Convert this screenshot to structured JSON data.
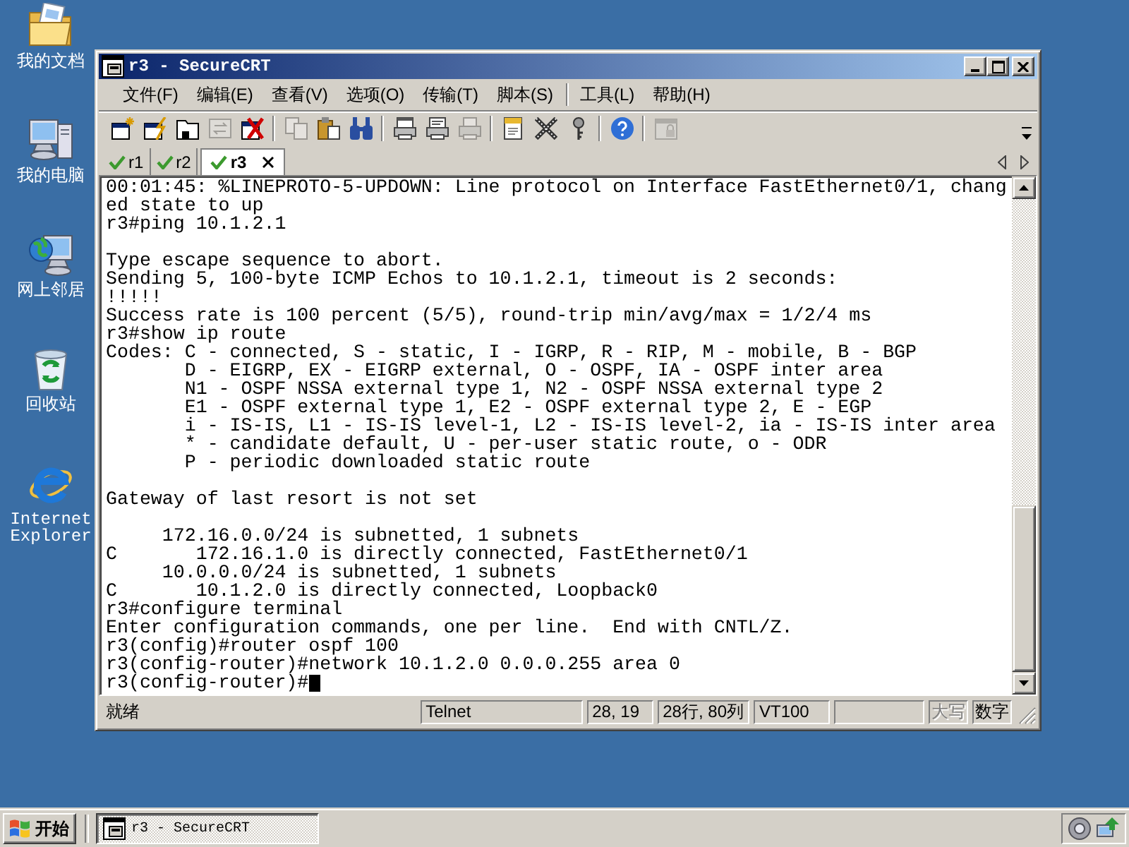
{
  "desktop_icons": [
    {
      "label": "我的文档",
      "kind": "documents"
    },
    {
      "label": "我的电脑",
      "kind": "computer"
    },
    {
      "label": "网上邻居",
      "kind": "network"
    },
    {
      "label": "回收站",
      "kind": "recycle-bin"
    },
    {
      "label": "Internet Explorer",
      "kind": "browser"
    }
  ],
  "window": {
    "title": "r3 - SecureCRT"
  },
  "menu": {
    "groups": [
      [
        "文件(F)",
        "编辑(E)",
        "查看(V)",
        "选项(O)",
        "传输(T)",
        "脚本(S)"
      ],
      [
        "工具(L)",
        "帮助(H)"
      ]
    ]
  },
  "toolbar": {
    "groups": [
      [
        {
          "kind": "new-session",
          "disabled": false
        },
        {
          "kind": "quick-connect",
          "disabled": false
        },
        {
          "kind": "connect-tab",
          "disabled": false
        },
        {
          "kind": "reconnect",
          "disabled": true
        },
        {
          "kind": "disconnect",
          "disabled": false
        }
      ],
      [
        {
          "kind": "copy",
          "disabled": true
        },
        {
          "kind": "paste",
          "disabled": false
        },
        {
          "kind": "find",
          "disabled": false
        }
      ],
      [
        {
          "kind": "print-screen",
          "disabled": false
        },
        {
          "kind": "print-selection",
          "disabled": false
        },
        {
          "kind": "print",
          "disabled": true
        }
      ],
      [
        {
          "kind": "properties",
          "disabled": false
        },
        {
          "kind": "keymap",
          "disabled": false
        },
        {
          "kind": "key",
          "disabled": false
        }
      ],
      [
        {
          "kind": "help",
          "disabled": false
        }
      ],
      [
        {
          "kind": "lock",
          "disabled": true
        }
      ]
    ]
  },
  "tabs": [
    {
      "label": "r1",
      "selected": false,
      "connected": true
    },
    {
      "label": "r2",
      "selected": false,
      "connected": true
    },
    {
      "label": "r3",
      "selected": true,
      "connected": true
    }
  ],
  "terminal": {
    "blocks": [
      [
        "00:01:45: %LINEPROTO-5-UPDOWN: Line protocol on Interface FastEthernet0/1, chang",
        "ed state to up",
        "r3#ping 10.1.2.1"
      ],
      [
        "Type escape sequence to abort.",
        "Sending 5, 100-byte ICMP Echos to 10.1.2.1, timeout is 2 seconds:",
        "!!!!!",
        "Success rate is 100 percent (5/5), round-trip min/avg/max = 1/2/4 ms",
        "r3#show ip route",
        "Codes: C - connected, S - static, I - IGRP, R - RIP, M - mobile, B - BGP",
        "       D - EIGRP, EX - EIGRP external, O - OSPF, IA - OSPF inter area",
        "       N1 - OSPF NSSA external type 1, N2 - OSPF NSSA external type 2",
        "       E1 - OSPF external type 1, E2 - OSPF external type 2, E - EGP",
        "       i - IS-IS, L1 - IS-IS level-1, L2 - IS-IS level-2, ia - IS-IS inter area",
        "       * - candidate default, U - per-user static route, o - ODR",
        "       P - periodic downloaded static route"
      ],
      [
        "Gateway of last resort is not set"
      ],
      [
        "     172.16.0.0/24 is subnetted, 1 subnets",
        "C       172.16.1.0 is directly connected, FastEthernet0/1",
        "     10.0.0.0/24 is subnetted, 1 subnets",
        "C       10.1.2.0 is directly connected, Loopback0",
        "r3#configure terminal",
        "Enter configuration commands, one per line.  End with CNTL/Z.",
        "r3(config)#router ospf 100",
        "r3(config-router)#network 10.1.2.0 0.0.0.255 area 0",
        "r3(config-router)#"
      ]
    ],
    "cursor": true
  },
  "status_bar": {
    "message": "就绪",
    "fields": [
      "Telnet",
      "28, 19",
      "28行, 80列",
      "VT100"
    ],
    "indicators": [
      {
        "label": "大写",
        "on": false
      },
      {
        "label": "数字",
        "on": true
      }
    ]
  },
  "taskbar": {
    "start": "开始",
    "tasks": [
      {
        "label": "r3 - SecureCRT",
        "selected": true
      }
    ]
  }
}
